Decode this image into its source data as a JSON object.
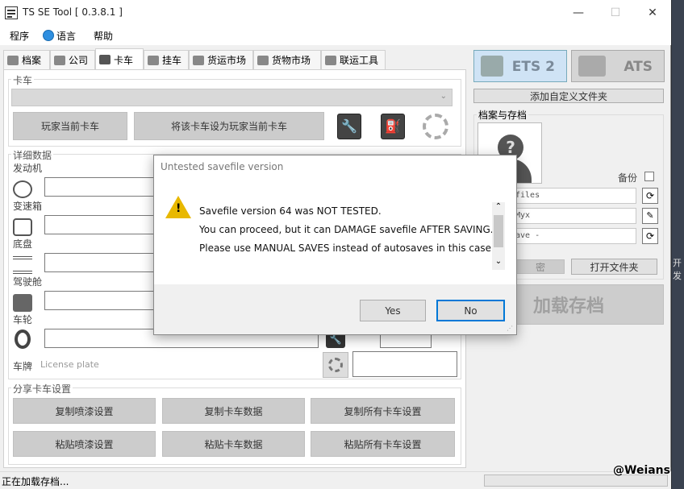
{
  "window": {
    "title": "TS SE Tool [ 0.3.8.1 ]",
    "minimize": "—",
    "maximize": "☐",
    "close": "✕"
  },
  "menu": {
    "program": "程序",
    "language": "语言",
    "help": "帮助"
  },
  "tabs": [
    {
      "label": "档案"
    },
    {
      "label": "公司"
    },
    {
      "label": "卡车"
    },
    {
      "label": "挂车"
    },
    {
      "label": "货运市场"
    },
    {
      "label": "货物市场"
    },
    {
      "label": "联运工具"
    }
  ],
  "truck_tab": {
    "truck_group_label": "卡车",
    "player_current_truck": "玩家当前卡车",
    "set_as_player_truck": "将该卡车设为玩家当前卡车",
    "details_group_label": "详细数据",
    "parts": [
      {
        "label": "发动机"
      },
      {
        "label": "变速箱"
      },
      {
        "label": "底盘"
      },
      {
        "label": "驾驶舱"
      },
      {
        "label": "车轮"
      }
    ],
    "plate_label": "车牌",
    "plate_placeholder": "License plate",
    "share_group_label": "分享卡车设置",
    "copy_paint": "复制喷漆设置",
    "copy_truck_data": "复制卡车数据",
    "copy_all_truck": "复制所有卡车设置",
    "paste_paint": "粘贴喷漆设置",
    "paste_truck_data": "粘贴卡车数据",
    "paste_all_truck": "粘贴所有卡车设置"
  },
  "right_panel": {
    "ets2": "ETS 2",
    "ats": "ATS",
    "add_custom_folder": "添加自定义文件夹",
    "profiles_group_label": "档案与存档",
    "backup_label": "备份",
    "combo1": "files",
    "combo2": "Myx",
    "combo3": "ave -",
    "password_btn": "密",
    "open_folder": "打开文件夹",
    "load_save": "加载存档"
  },
  "dialog": {
    "title": "Untested savefile version",
    "line1": "Savefile version 64 was NOT TESTED.",
    "line2": "You can proceed, but it can DAMAGE savefile AFTER SAVING.",
    "line3": "Please use MANUAL SAVES instead of autosaves in this case!",
    "yes": "Yes",
    "no": "No"
  },
  "status": {
    "text": "正在加载存档..."
  },
  "watermark": "@Weians",
  "edge_text": "开发"
}
